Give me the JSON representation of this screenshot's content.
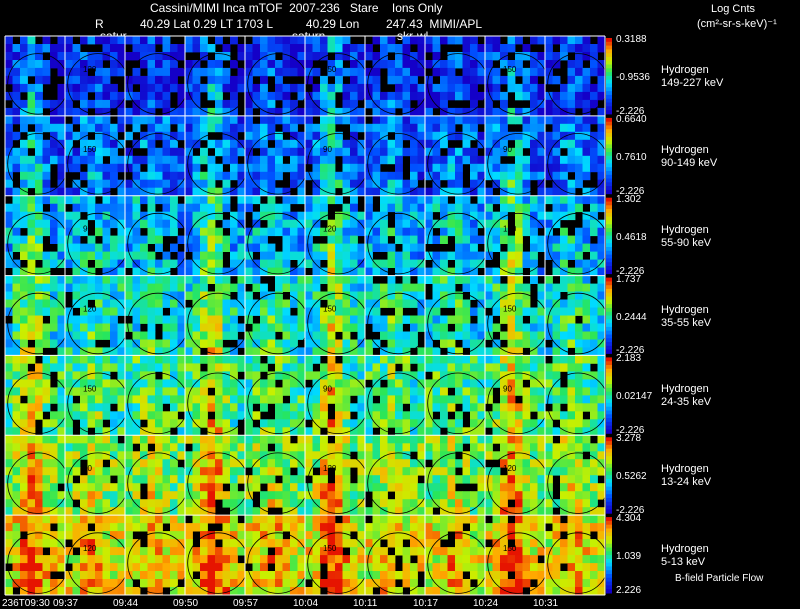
{
  "header": {
    "title": "Cassini/MIMI Inca mTOF  2007-236   Stare    Ions Only",
    "line2_r": "R",
    "line2_rest": "40.29 Lat 0.29 LT 1703 L          40.29 Lon        247.43  MIMI/APL",
    "units_line1": "Log Cnts",
    "units_line2": "(cm²-sr-s-keV)⁻¹",
    "overlay_labels": [
      "satur",
      "saturn",
      "skr-wl"
    ]
  },
  "footer": {
    "flow_label": "B-field Particle Flow",
    "time_ticks": [
      "236T09:30",
      "09:37",
      "09:44",
      "09:50",
      "09:57",
      "10:04",
      "10:11",
      "10:17",
      "10:24",
      "10:31"
    ]
  },
  "colors": {
    "bg": "#000000",
    "grid": "#ffffff",
    "contour": "#000000"
  },
  "chart_data": {
    "type": "heatmap",
    "title": "Cassini/MIMI Inca mTOF  2007-236   Stare    Ions Only",
    "x_ticks": [
      "236T09:30",
      "09:37",
      "09:44",
      "09:50",
      "09:57",
      "10:04",
      "10:11",
      "10:17",
      "10:24",
      "10:31"
    ],
    "colorbar_label": "Log Cnts (cm²-sr-s-keV)⁻¹",
    "colormap": "rainbow (blue → cyan → green → yellow → red)",
    "contour_labels": [
      "90",
      "120",
      "150"
    ],
    "channels": [
      {
        "species": "Hydrogen",
        "energy": "149-227 keV",
        "max": "0.3188",
        "mid": "-0.9536",
        "min": "-2.226",
        "intensity": 0.08
      },
      {
        "species": "Hydrogen",
        "energy": "90-149 keV",
        "max": "0.6640",
        "mid": "0.7610",
        "min": "-2.226",
        "intensity": 0.18
      },
      {
        "species": "Hydrogen",
        "energy": "55-90 keV",
        "max": "1.302",
        "mid": "0.4618",
        "min": "-2.226",
        "intensity": 0.32
      },
      {
        "species": "Hydrogen",
        "energy": "35-55 keV",
        "max": "1.737",
        "mid": "0.2444",
        "min": "-2.226",
        "intensity": 0.42
      },
      {
        "species": "Hydrogen",
        "energy": "24-35 keV",
        "max": "2.183",
        "mid": "0.02147",
        "min": "-2.226",
        "intensity": 0.5
      },
      {
        "species": "Hydrogen",
        "energy": "13-24 keV",
        "max": "3.278",
        "mid": "0.5262",
        "min": "-2.226",
        "intensity": 0.6
      },
      {
        "species": "Hydrogen",
        "energy": "5-13 keV",
        "max": "4.304",
        "mid": "1.039",
        "min": "2.226",
        "intensity": 0.72
      }
    ]
  }
}
